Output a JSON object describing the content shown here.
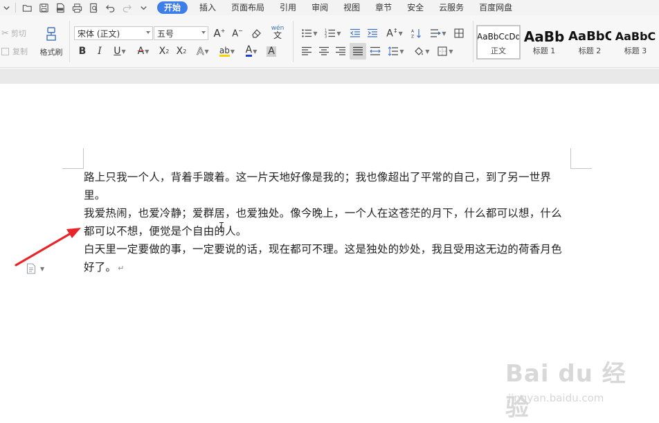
{
  "menubar": {
    "tabs": [
      {
        "label": "开始",
        "active": true
      },
      {
        "label": "插入"
      },
      {
        "label": "页面布局"
      },
      {
        "label": "引用"
      },
      {
        "label": "审阅"
      },
      {
        "label": "视图"
      },
      {
        "label": "章节"
      },
      {
        "label": "安全"
      },
      {
        "label": "云服务"
      },
      {
        "label": "百度网盘"
      }
    ],
    "quick_access_icons": [
      "chevron-down-icon",
      "open-folder-icon",
      "save-icon",
      "export-pdf-icon",
      "print-icon",
      "print-preview-icon",
      "undo-icon",
      "redo-icon",
      "customize-dropdown-icon"
    ]
  },
  "ribbon": {
    "clipboard": {
      "cut": "剪切",
      "copy": "复制",
      "format_painter": "格式刷"
    },
    "font": {
      "font_name": "宋体 (正文)",
      "font_size": "五号",
      "phonetic_guide": "wén"
    },
    "styles": [
      {
        "preview": "AaBbCcDd",
        "name": "正文",
        "selected": true
      },
      {
        "preview": "AaBb",
        "name": "标题 1"
      },
      {
        "preview": "AaBbC",
        "name": "标题 2"
      },
      {
        "preview": "AaBbC",
        "name": "标题 3"
      }
    ]
  },
  "document": {
    "paragraphs": [
      "路上只我一个人，背着手踱着。这一片天地好像是我的；我也像超出了平常的自己，到了另一世界里。",
      "我爱热闹，也爱冷静；爱群居，也爱独处。像今晚上，一个人在这苍茫的月下，什么都可以想，什么都可以不想，便觉是个自由的人。",
      "白天里一定要做的事，一定要说的话，现在都可不理。这是独处的妙处，我且受用这无边的荷香月色好了。"
    ],
    "paragraph_mark": "↵"
  },
  "annotation": {
    "arrow_color": "#e8262a"
  },
  "watermark": {
    "brand": "Bai du 经验",
    "url": "jingyan.baidu.com"
  },
  "colors": {
    "active_tab": "#3e7ee8",
    "highlight": "#f5d300",
    "font_color": "#1f3fd1",
    "ribbon_bg": "#f7f7f7"
  }
}
